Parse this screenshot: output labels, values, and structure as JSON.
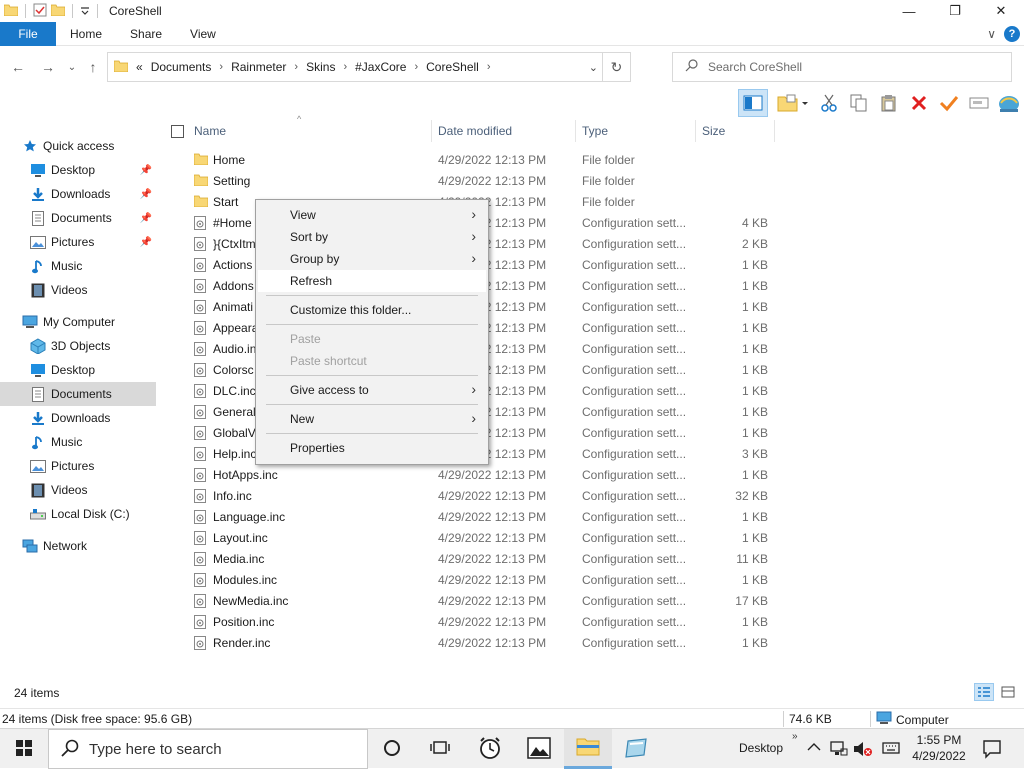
{
  "window": {
    "title": "CoreShell",
    "controls": {
      "minimize": "—",
      "maximize": "❐",
      "close": "✕"
    }
  },
  "ribbon": {
    "tabs": [
      {
        "label": "File"
      },
      {
        "label": "Home"
      },
      {
        "label": "Share"
      },
      {
        "label": "View"
      }
    ],
    "help": "?",
    "expand": "∨"
  },
  "address": {
    "overflow": "«",
    "breadcrumbs": [
      "Documents",
      "Rainmeter",
      "Skins",
      "#JaxCore",
      "CoreShell"
    ],
    "separator": "›"
  },
  "search": {
    "placeholder": "Search CoreShell"
  },
  "nav": {
    "quick_access": "Quick access",
    "quick_items": [
      {
        "label": "Desktop",
        "icon": "desktop-icon"
      },
      {
        "label": "Downloads",
        "icon": "downloads-icon"
      },
      {
        "label": "Documents",
        "icon": "documents-icon"
      },
      {
        "label": "Pictures",
        "icon": "pictures-icon"
      },
      {
        "label": "Music",
        "icon": "music-icon"
      },
      {
        "label": "Videos",
        "icon": "videos-icon"
      }
    ],
    "computer": "My Computer",
    "computer_items": [
      {
        "label": "3D Objects",
        "icon": "3d-objects-icon"
      },
      {
        "label": "Desktop",
        "icon": "desktop-icon"
      },
      {
        "label": "Documents",
        "icon": "documents-icon"
      },
      {
        "label": "Downloads",
        "icon": "downloads-icon"
      },
      {
        "label": "Music",
        "icon": "music-icon"
      },
      {
        "label": "Pictures",
        "icon": "pictures-icon"
      },
      {
        "label": "Videos",
        "icon": "videos-icon"
      },
      {
        "label": "Local Disk (C:)",
        "icon": "drive-icon"
      }
    ],
    "network": "Network"
  },
  "list": {
    "columns": {
      "name": "Name",
      "date": "Date modified",
      "type": "Type",
      "size": "Size"
    },
    "rows": [
      {
        "name": "Home",
        "date": "4/29/2022 12:13 PM",
        "type": "File folder",
        "size": "",
        "kind": "folder"
      },
      {
        "name": "Setting",
        "date": "4/29/2022 12:13 PM",
        "type": "File folder",
        "size": "",
        "kind": "folder"
      },
      {
        "name": "Start",
        "date": "4/29/2022 12:13 PM",
        "type": "File folder",
        "size": "",
        "kind": "folder"
      },
      {
        "name": "#Home",
        "date": "4/29/2022 12:13 PM",
        "type": "Configuration sett...",
        "size": "4 KB",
        "kind": "file"
      },
      {
        "name": "}{CtxItm",
        "date": "4/29/2022 12:13 PM",
        "type": "Configuration sett...",
        "size": "2 KB",
        "kind": "file"
      },
      {
        "name": "Actions",
        "date": "4/29/2022 12:13 PM",
        "type": "Configuration sett...",
        "size": "1 KB",
        "kind": "file"
      },
      {
        "name": "Addons",
        "date": "4/29/2022 12:13 PM",
        "type": "Configuration sett...",
        "size": "1 KB",
        "kind": "file"
      },
      {
        "name": "Animati",
        "date": "4/29/2022 12:13 PM",
        "type": "Configuration sett...",
        "size": "1 KB",
        "kind": "file"
      },
      {
        "name": "Appeara",
        "date": "4/29/2022 12:13 PM",
        "type": "Configuration sett...",
        "size": "1 KB",
        "kind": "file"
      },
      {
        "name": "Audio.in",
        "date": "4/29/2022 12:13 PM",
        "type": "Configuration sett...",
        "size": "1 KB",
        "kind": "file"
      },
      {
        "name": "Colorsc",
        "date": "4/29/2022 12:13 PM",
        "type": "Configuration sett...",
        "size": "1 KB",
        "kind": "file"
      },
      {
        "name": "DLC.inc",
        "date": "4/29/2022 12:13 PM",
        "type": "Configuration sett...",
        "size": "1 KB",
        "kind": "file"
      },
      {
        "name": "General",
        "date": "4/29/2022 12:13 PM",
        "type": "Configuration sett...",
        "size": "1 KB",
        "kind": "file"
      },
      {
        "name": "GlobalV",
        "date": "4/29/2022 12:13 PM",
        "type": "Configuration sett...",
        "size": "1 KB",
        "kind": "file"
      },
      {
        "name": "Help.inc",
        "date": "4/29/2022 12:13 PM",
        "type": "Configuration sett...",
        "size": "3 KB",
        "kind": "file"
      },
      {
        "name": "HotApps.inc",
        "date": "4/29/2022 12:13 PM",
        "type": "Configuration sett...",
        "size": "1 KB",
        "kind": "file"
      },
      {
        "name": "Info.inc",
        "date": "4/29/2022 12:13 PM",
        "type": "Configuration sett...",
        "size": "32 KB",
        "kind": "file"
      },
      {
        "name": "Language.inc",
        "date": "4/29/2022 12:13 PM",
        "type": "Configuration sett...",
        "size": "1 KB",
        "kind": "file"
      },
      {
        "name": "Layout.inc",
        "date": "4/29/2022 12:13 PM",
        "type": "Configuration sett...",
        "size": "1 KB",
        "kind": "file"
      },
      {
        "name": "Media.inc",
        "date": "4/29/2022 12:13 PM",
        "type": "Configuration sett...",
        "size": "11 KB",
        "kind": "file"
      },
      {
        "name": "Modules.inc",
        "date": "4/29/2022 12:13 PM",
        "type": "Configuration sett...",
        "size": "1 KB",
        "kind": "file"
      },
      {
        "name": "NewMedia.inc",
        "date": "4/29/2022 12:13 PM",
        "type": "Configuration sett...",
        "size": "17 KB",
        "kind": "file"
      },
      {
        "name": "Position.inc",
        "date": "4/29/2022 12:13 PM",
        "type": "Configuration sett...",
        "size": "1 KB",
        "kind": "file"
      },
      {
        "name": "Render.inc",
        "date": "4/29/2022 12:13 PM",
        "type": "Configuration sett...",
        "size": "1 KB",
        "kind": "file"
      }
    ]
  },
  "context_menu": {
    "items": [
      {
        "label": "View",
        "submenu": true,
        "disabled": false
      },
      {
        "label": "Sort by",
        "submenu": true,
        "disabled": false
      },
      {
        "label": "Group by",
        "submenu": true,
        "disabled": false
      },
      {
        "label": "Refresh",
        "submenu": false,
        "disabled": false,
        "highlighted": true
      },
      {
        "label": "Customize this folder...",
        "submenu": false,
        "disabled": false
      },
      {
        "label": "Paste",
        "submenu": false,
        "disabled": true
      },
      {
        "label": "Paste shortcut",
        "submenu": false,
        "disabled": true
      },
      {
        "label": "Give access to",
        "submenu": true,
        "disabled": false
      },
      {
        "label": "New",
        "submenu": true,
        "disabled": false
      },
      {
        "label": "Properties",
        "submenu": false,
        "disabled": false
      }
    ],
    "arrow": "›"
  },
  "status": {
    "item_count": "24 items",
    "detail": "24 items (Disk free space: 95.6 GB)",
    "size": "74.6 KB",
    "location": "Computer"
  },
  "taskbar": {
    "search_placeholder": "Type here to search",
    "desktop_label": "Desktop",
    "time": "1:55 PM",
    "date": "4/29/2022"
  },
  "colors": {
    "accent": "#1979ca",
    "folder": "#f8d775",
    "selection": "#cce4f7"
  }
}
